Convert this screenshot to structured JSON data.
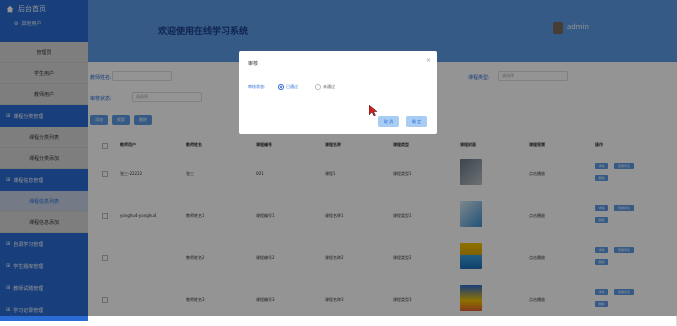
{
  "sidebar": {
    "brand": "后台首页",
    "sub": "其他用户",
    "items": [
      {
        "label": "管理员"
      },
      {
        "label": "学生用户"
      },
      {
        "label": "教师用户"
      }
    ],
    "group1": "课程分类管理",
    "g1items": [
      {
        "label": "课程分类列表"
      },
      {
        "label": "课程分类添加"
      }
    ],
    "group2": "课程信息管理",
    "g2items": [
      {
        "label": "课程信息列表"
      },
      {
        "label": "课程信息添加"
      }
    ],
    "group3": "自调学习管理",
    "group4": "学生题库管理",
    "group5": "教师试题管理",
    "group6": "学习记录管理"
  },
  "header": {
    "title": "欢迎使用在线学习系统",
    "user": "admin"
  },
  "filters": {
    "course_name_label": "教师姓名:",
    "course_type_label": "课程类型:",
    "course_type_placeholder": "请选择",
    "status_label": "审核状态:",
    "status_placeholder": "请选择"
  },
  "toolbar": {
    "btn1": "添加",
    "btn2": "搜索",
    "btn3": "删除"
  },
  "table": {
    "headers": [
      "教师用户",
      "教师姓名",
      "课程编号",
      "课程名称",
      "课程类型",
      "课程封面",
      "课程视频",
      "操作"
    ],
    "rows": [
      {
        "user": "张三-22222",
        "name": "张三",
        "code": "001",
        "cname": "课程1",
        "ctype": "课程类型1",
        "video": "点击播放"
      },
      {
        "user": "yonghu4-yonghu4",
        "name": "教师姓名1",
        "code": "课程编号1",
        "cname": "课程名称1",
        "ctype": "课程类型1",
        "video": "点击播放"
      },
      {
        "user": "",
        "name": "教师姓名2",
        "code": "课程编号2",
        "cname": "课程名称2",
        "ctype": "课程类型2",
        "video": "点击播放"
      },
      {
        "user": "",
        "name": "教师姓名3",
        "code": "课程编号3",
        "cname": "课程名称3",
        "ctype": "课程类型3",
        "video": "点击播放"
      }
    ],
    "op_view": "详情",
    "op_edit": "查看评论",
    "op_del": "删除"
  },
  "dialog": {
    "title": "审核",
    "close": "×",
    "status_label": "审核状态:",
    "opt_pass": "已通过",
    "opt_fail": "未通过",
    "cancel": "取 消",
    "ok": "确 定"
  },
  "colors": {
    "primary": "#2a6bd5",
    "header": "#5b9be6"
  }
}
